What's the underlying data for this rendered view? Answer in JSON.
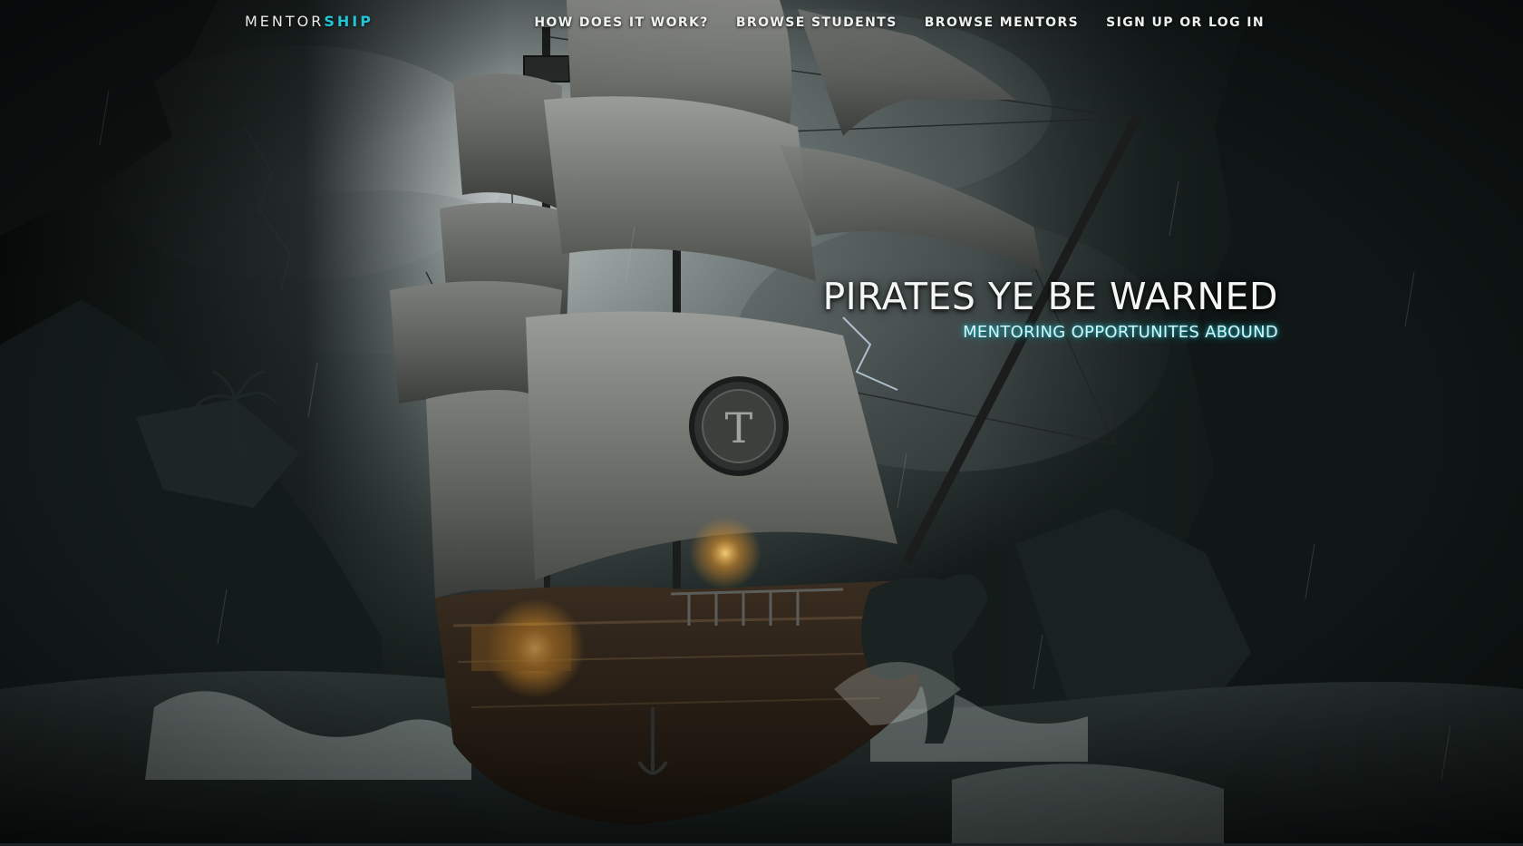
{
  "brand": {
    "name_main": "MENTOR",
    "name_accent": "SHIP",
    "accent_color": "#22c4d6"
  },
  "nav": {
    "items": [
      {
        "label": "HOW DOES IT WORK?"
      },
      {
        "label": "BROWSE STUDENTS"
      },
      {
        "label": "BROWSE MENTORS"
      },
      {
        "label": "SIGN UP OR LOG IN"
      }
    ]
  },
  "hero": {
    "title": "PIRATES YE BE WARNED",
    "subtitle": "MENTORING OPPORTUNITES ABOUND",
    "background": "stormy-sea-pirate-ship-illustration",
    "sail_emblem": "T"
  }
}
